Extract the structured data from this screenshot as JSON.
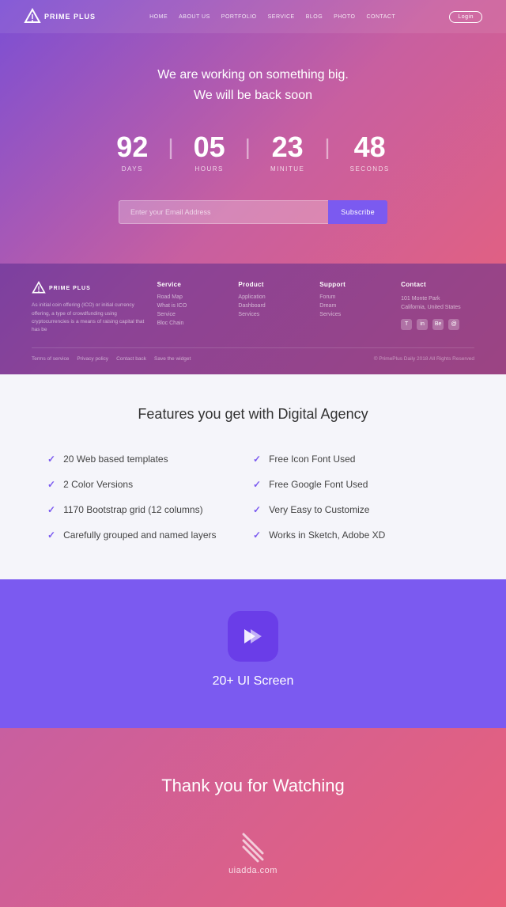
{
  "navbar": {
    "logo_text": "PRIME PLUS",
    "links": [
      "HOME",
      "ABOUT US",
      "PORTFOLIO",
      "SERVICE",
      "BLOG",
      "PHOTO",
      "CONTACT"
    ],
    "login_label": "Login"
  },
  "hero": {
    "title_line1": "We are working on something big.",
    "title_line2": "We will be back soon",
    "timer": {
      "days_value": "92",
      "days_label": "DAYS",
      "hours_value": "05",
      "hours_label": "HOURS",
      "minutes_value": "23",
      "minutes_label": "MINITUE",
      "seconds_value": "48",
      "seconds_label": "SECONDS"
    },
    "subscribe_placeholder": "Enter your Email Address",
    "subscribe_btn": "Subscribe"
  },
  "hero_footer": {
    "brand_description": "As initial coin offering (ICO) or initial currency offering, a type of crowdfunding using cryptocurrencies is a means of raising capital that has be",
    "columns": [
      {
        "title": "Service",
        "links": [
          "Road Map",
          "What is ICO",
          "Service",
          "Bloc Chain"
        ]
      },
      {
        "title": "Product",
        "links": [
          "Application",
          "Dashboard",
          "Services"
        ]
      },
      {
        "title": "Support",
        "links": [
          "Forum",
          "Dream",
          "Services"
        ]
      },
      {
        "title": "Contact",
        "address_line1": "101 Monte Park",
        "address_line2": "California, United States",
        "social": [
          "T",
          "in",
          "Be",
          "@"
        ]
      }
    ],
    "bottom_links": [
      "Terms of service",
      "Privacy policy",
      "Contact back",
      "Save the widget"
    ],
    "copyright": "© PrimePlus Daily 2018 All Rights Reserved"
  },
  "features": {
    "title": "Features you get with Digital Agency",
    "items_left": [
      "20 Web based templates",
      "2 Color Versions",
      "1170 Bootstrap grid (12 columns)",
      "Carefully grouped and named layers"
    ],
    "items_right": [
      "Free Icon Font Used",
      "Free Google Font Used",
      "Very Easy to Customize",
      "Works in Sketch, Adobe XD"
    ]
  },
  "app_section": {
    "screen_count": "20+ UI Screen"
  },
  "thankyou": {
    "text": "Thank you for Watching",
    "brand": "uiadda.com"
  }
}
